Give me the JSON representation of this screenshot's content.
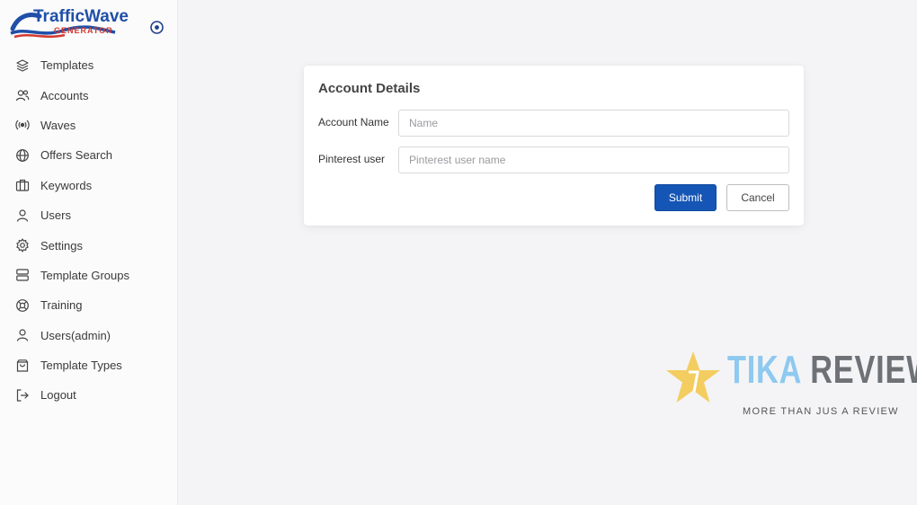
{
  "app": {
    "logo_primary": "TrafficWave",
    "logo_secondary": "GENERATOR"
  },
  "sidebar": {
    "items": [
      {
        "label": "Templates",
        "icon": "layers-icon"
      },
      {
        "label": "Accounts",
        "icon": "users-icon"
      },
      {
        "label": "Waves",
        "icon": "broadcast-icon"
      },
      {
        "label": "Offers Search",
        "icon": "globe-icon"
      },
      {
        "label": "Keywords",
        "icon": "briefcase-icon"
      },
      {
        "label": "Users",
        "icon": "user-icon"
      },
      {
        "label": "Settings",
        "icon": "gear-icon"
      },
      {
        "label": "Template Groups",
        "icon": "server-icon"
      },
      {
        "label": "Training",
        "icon": "lifebuoy-icon"
      },
      {
        "label": "Users(admin)",
        "icon": "user-icon"
      },
      {
        "label": "Template Types",
        "icon": "bag-icon"
      },
      {
        "label": "Logout",
        "icon": "logout-icon"
      }
    ]
  },
  "form": {
    "title": "Account Details",
    "fields": [
      {
        "label": "Account Name",
        "value": "",
        "placeholder": "Name"
      },
      {
        "label": "Pinterest user",
        "value": "",
        "placeholder": "Pinterest user name"
      }
    ],
    "submit_label": "Submit",
    "cancel_label": "Cancel"
  },
  "watermark": {
    "title_part1": "TIKA",
    "title_part2": "REVIEW",
    "subtitle": "MORE THAN JUS A REVIEW"
  },
  "colors": {
    "primary": "#1555b5",
    "logo_blue": "#1f4fa8",
    "logo_red": "#d43a2f",
    "watermark_blue": "#8ec9ef",
    "watermark_star": "#f3cd60"
  }
}
